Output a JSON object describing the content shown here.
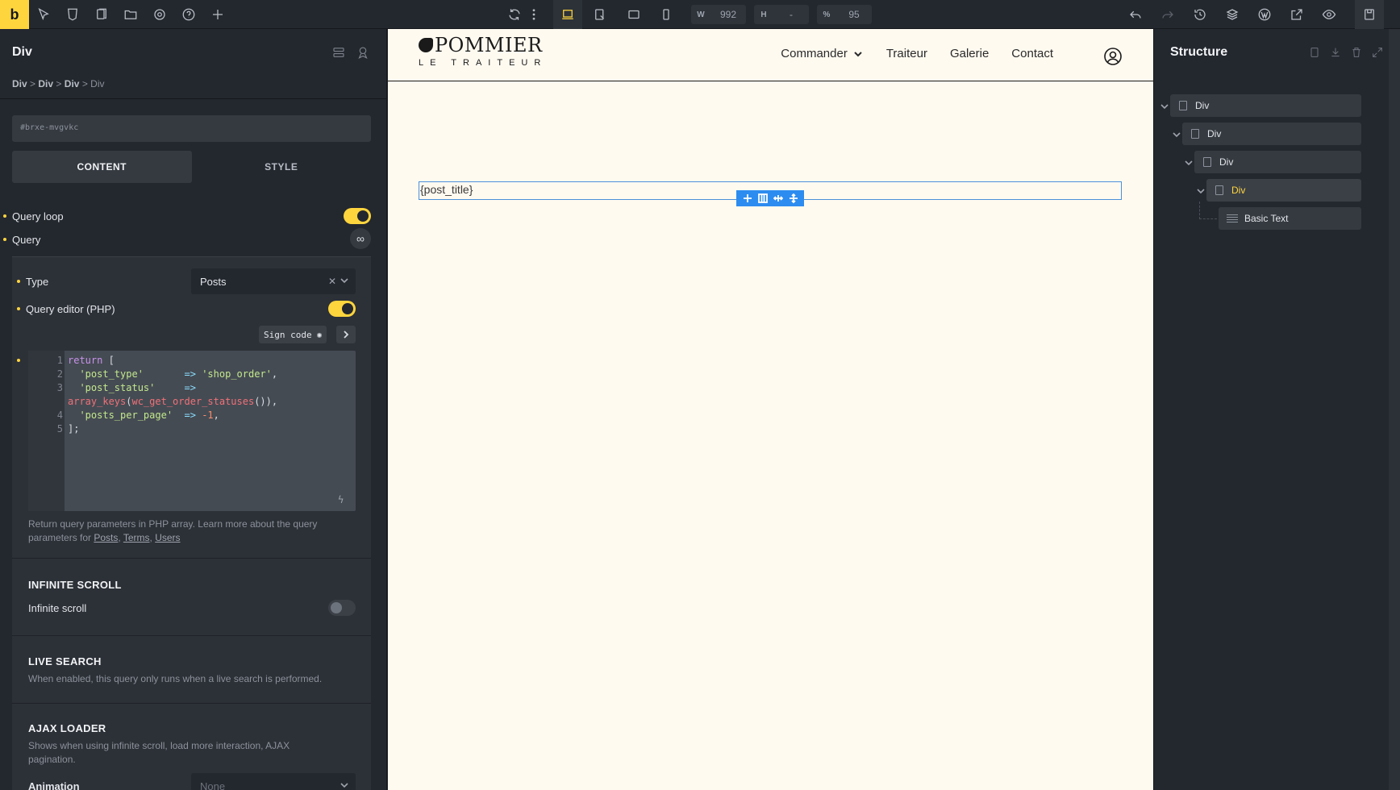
{
  "topbar": {
    "logo": "b",
    "width_label": "W",
    "width_value": "992",
    "height_label": "H",
    "height_value": "-",
    "zoom_label": "%",
    "zoom_value": "95"
  },
  "left_panel": {
    "title": "Div",
    "breadcrumb": [
      "Div",
      "Div",
      "Div",
      "Div"
    ],
    "breadcrumb_sep": ">",
    "element_id": "#brxe-mvgvkc",
    "tabs": [
      "CONTENT",
      "STYLE"
    ],
    "query_loop_label": "Query loop",
    "query_loop_on": true,
    "query_label": "Query",
    "query_icon": "∞",
    "type_label": "Type",
    "type_value": "Posts",
    "type_clear": "✕",
    "query_editor_label": "Query editor (PHP)",
    "query_editor_on": true,
    "sign_code_label": "Sign code",
    "code_line_numbers": [
      "1",
      "2",
      "3",
      "",
      "4",
      "5"
    ],
    "code_lines": [
      "return [",
      "  'post_type'       => 'shop_order',",
      "  'post_status'     =>",
      "array_keys(wc_get_order_statuses()),",
      "  'posts_per_page'  => -1,",
      "];"
    ],
    "hint_text": "Return query parameters in PHP array. Learn more about the query parameters for",
    "hint_links": [
      "Posts",
      "Terms",
      "Users"
    ],
    "infinite_scroll_heading": "INFINITE SCROLL",
    "infinite_scroll_label": "Infinite scroll",
    "infinite_scroll_on": false,
    "live_search_heading": "LIVE SEARCH",
    "live_search_desc": "When enabled, this query only runs when a live search is performed.",
    "ajax_loader_heading": "AJAX LOADER",
    "ajax_loader_desc": "Shows when using infinite scroll, load more interaction, AJAX pagination.",
    "animation_label": "Animation",
    "animation_value": "None"
  },
  "canvas": {
    "brand_name": "POMMIER",
    "brand_sub": "LE TRAITEUR",
    "nav": [
      "Commander",
      "Traiteur",
      "Galerie",
      "Contact"
    ],
    "placeholder": "{post_title}"
  },
  "right_panel": {
    "title": "Structure",
    "tree": [
      "Div",
      "Div",
      "Div",
      "Div",
      "Basic Text"
    ]
  },
  "colors": {
    "accent": "#ffd53e",
    "panel": "#23272e",
    "canvas_bg": "#fffaf0",
    "select_blue": "#2d8cf0"
  }
}
